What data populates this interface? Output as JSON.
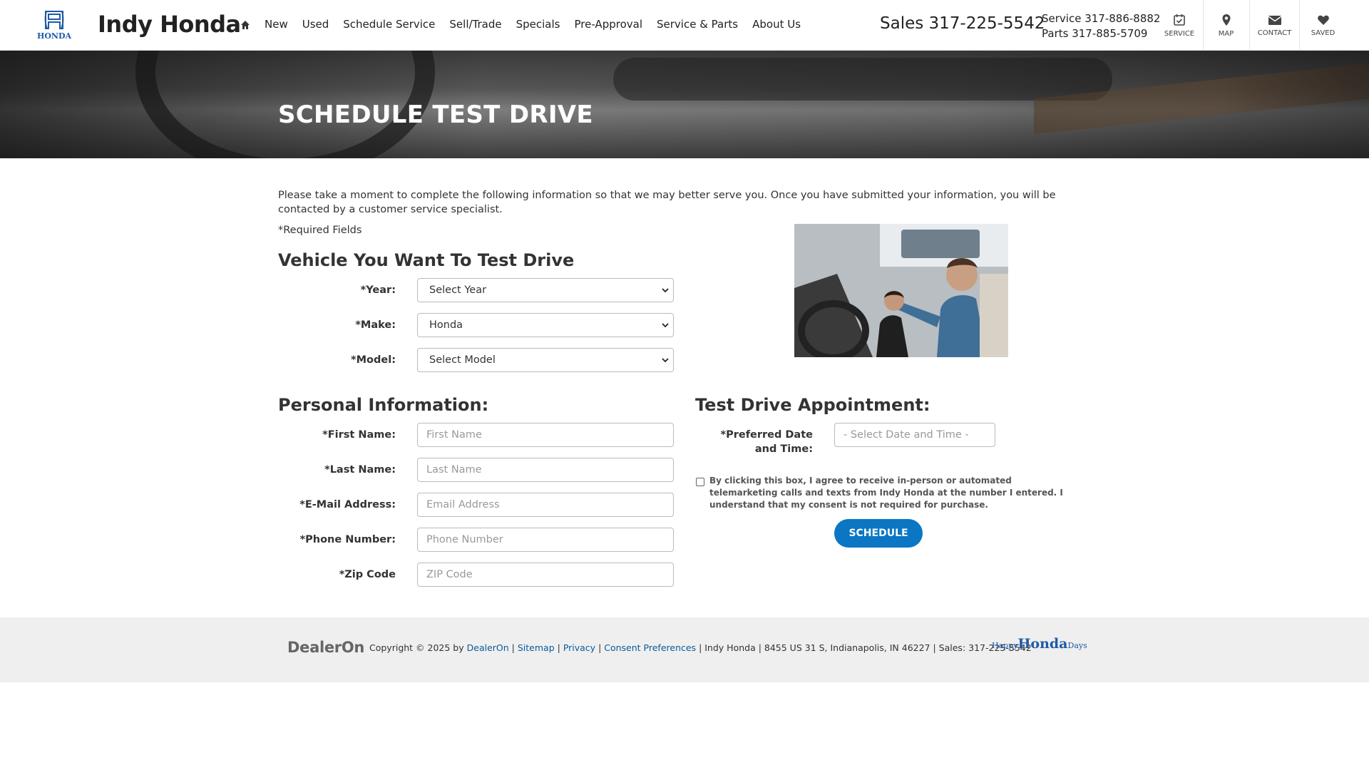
{
  "header": {
    "brand": "Indy Honda",
    "logo_text": "HONDA",
    "nav": [
      "New",
      "Used",
      "Schedule Service",
      "Sell/Trade",
      "Specials",
      "Pre-Approval",
      "Service & Parts",
      "About Us"
    ],
    "sales": "Sales 317-225-5542",
    "service_phone": "Service 317-886-8882",
    "parts_phone": "Parts 317-885-5709",
    "utils": {
      "service": "SERVICE",
      "map": "MAP",
      "contact": "CONTACT",
      "saved": "SAVED"
    }
  },
  "hero": {
    "title": "SCHEDULE TEST DRIVE"
  },
  "intro": "Please take a moment to complete the following information so that we may better serve you. Once you have submitted your information, you will be contacted by a customer service specialist.",
  "required_note": "*Required Fields",
  "vehicle": {
    "heading": "Vehicle You Want To Test Drive",
    "year_label": "*Year:",
    "year_value": "Select Year",
    "make_label": "*Make:",
    "make_value": "Honda",
    "model_label": "*Model:",
    "model_value": "Select Model"
  },
  "personal": {
    "heading": "Personal Information:",
    "first_label": "*First Name:",
    "first_placeholder": "First Name",
    "last_label": "*Last Name:",
    "last_placeholder": "Last Name",
    "email_label": "*E-Mail Address:",
    "email_placeholder": "Email Address",
    "phone_label": "*Phone Number:",
    "phone_placeholder": "Phone Number",
    "zip_label": "*Zip Code",
    "zip_placeholder": "ZIP Code"
  },
  "appointment": {
    "heading": "Test Drive Appointment:",
    "date_label": "*Preferred Date and Time:",
    "date_placeholder": "- Select Date and Time -",
    "consent": "By clicking this box, I agree to receive in-person or automated telemarketing calls and texts from Indy Honda at the number I entered. I understand that my consent is not required for purchase.",
    "button": "SCHEDULE"
  },
  "footer": {
    "dealeron_logo": "DealerOn",
    "copyright": "Copyright © 2025 by",
    "dealeron_link": "DealerOn",
    "sitemap": "Sitemap",
    "privacy": "Privacy",
    "consent_prefs": "Consent Preferences",
    "dealer_info": "Indy Honda | 8455 US 31 S, Indianapolis, IN 46227 | Sales: 317-225-5542",
    "happy_small": "Happy",
    "happy_big": "Honda",
    "happy_days": "Days"
  },
  "colors": {
    "accent": "#0a76c4",
    "link": "#0a5a9c",
    "honda_blue": "#1d5ba5"
  }
}
